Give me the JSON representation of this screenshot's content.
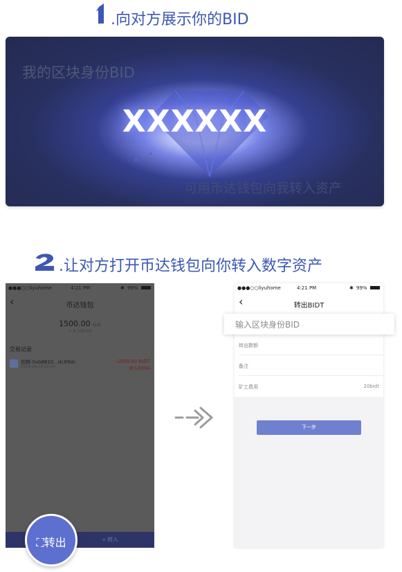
{
  "step1": {
    "number": "1",
    "title": ".向对方展示你的BID"
  },
  "card": {
    "title": "我的区块身份BID",
    "bid_value": "XXXXXX",
    "hint": "可用币达钱包向我转入资产"
  },
  "step2": {
    "number": "2",
    "title": ".让对方打开币达钱包向你转入数字资产"
  },
  "phone1": {
    "status": {
      "carrier": "●●●○○liyuhome",
      "time": "4:21 PM",
      "battery": "99%"
    },
    "back": "‹",
    "title": "币达钱包",
    "balance": "1500.00",
    "balance_unit": "bidt",
    "balance_sub": "≈ ¥ 150.00",
    "section_title": "交易记录",
    "transaction": {
      "name": "划转-0xb8810...dc89dc",
      "date": "2018-08-18  10:15",
      "amount": "-1000.00 BIDT",
      "status": "转入校验中"
    },
    "receive_label": "转入"
  },
  "transfer_button": {
    "label": "转出"
  },
  "phone2": {
    "status": {
      "carrier": "●●●○○liyuhome",
      "time": "4:21 PM",
      "battery": "99%"
    },
    "back": "‹",
    "title": "转出BIDT",
    "bid_placeholder": "输入区块身份BID",
    "amount_label": "转出数额",
    "note_label": "备注",
    "fee_label": "矿工费用",
    "fee_value": "20bidt",
    "next_label": "下一步"
  },
  "colors": {
    "accent": "#3d57b4",
    "button": "#6f80cf",
    "card_dark": "#242a50"
  }
}
